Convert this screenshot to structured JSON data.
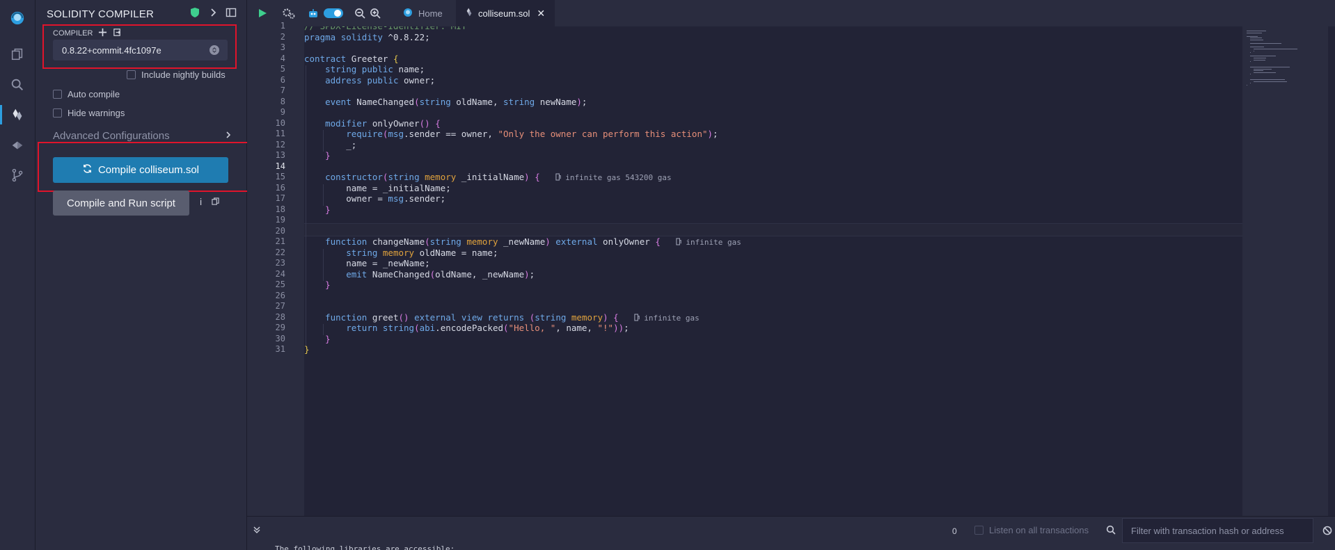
{
  "panel": {
    "title": "SOLIDITY COMPILER",
    "compiler_label": "COMPILER",
    "compiler_version": "0.8.22+commit.4fc1097e",
    "include_nightly": "Include nightly builds",
    "auto_compile": "Auto compile",
    "hide_warnings": "Hide warnings",
    "advanced": "Advanced Configurations",
    "compile_button": "Compile colliseum.sol",
    "run_button": "Compile and Run script",
    "info_glyph": "i"
  },
  "tabs": {
    "home": "Home",
    "file": "colliseum.sol",
    "close": "✕"
  },
  "editor": {
    "lines": [
      "// SPDX-License-Identifier: MIT",
      "pragma solidity ^0.8.22;",
      "",
      "contract Greeter {",
      "    string public name;",
      "    address public owner;",
      "",
      "    event NameChanged(string oldName, string newName);",
      "",
      "    modifier onlyOwner() {",
      "        require(msg.sender == owner, \"Only the owner can perform this action\");",
      "        _;",
      "    }",
      "",
      "    constructor(string memory _initialName) {",
      "        name = _initialName;",
      "        owner = msg.sender;",
      "    }",
      "",
      "",
      "    function changeName(string memory _newName) external onlyOwner {",
      "        string memory oldName = name;",
      "        name = _newName;",
      "        emit NameChanged(oldName, _newName);",
      "    }",
      "",
      "",
      "    function greet() external view returns (string memory) {",
      "        return string(abi.encodePacked(\"Hello, \", name, \"!\"));",
      "    }",
      "}"
    ],
    "gas_hints": {
      "constructor": "infinite gas 543200 gas",
      "changeName": "infinite gas",
      "greet": "infinite gas"
    },
    "current_line": 14
  },
  "terminal": {
    "count": "0",
    "listen": "Listen on all transactions",
    "filter_placeholder": "Filter with transaction hash or address",
    "output_text": "The following libraries are accessible:"
  },
  "colors": {
    "accent": "#1f7cb1",
    "highlight_box": "#e0142b",
    "background": "#222336",
    "panel": "#2a2c3f"
  }
}
